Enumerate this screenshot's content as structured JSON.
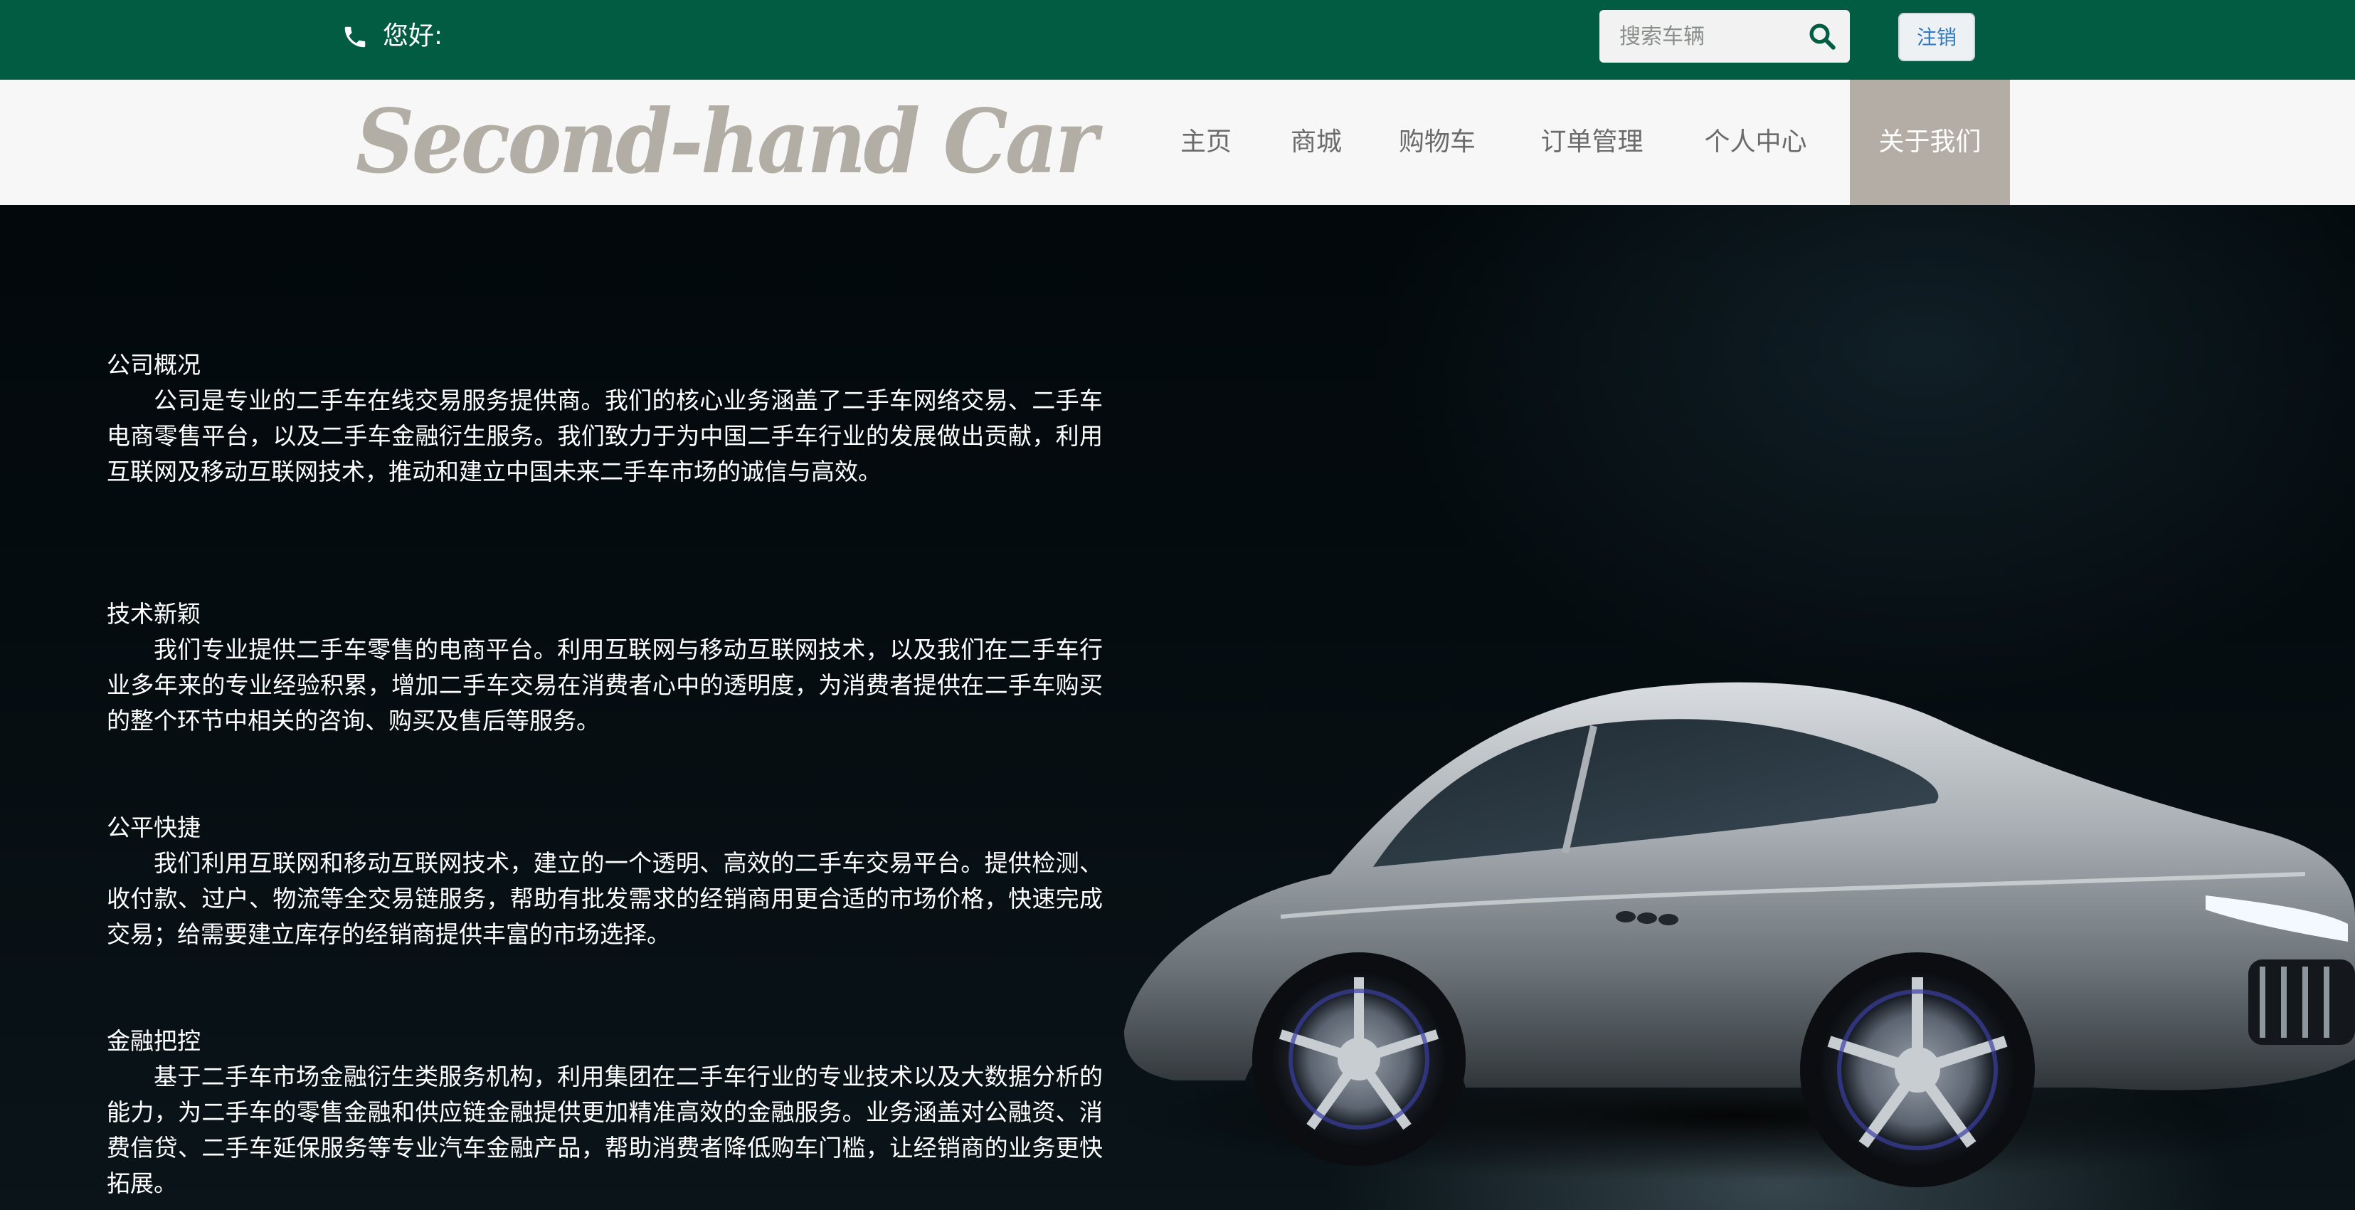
{
  "topbar": {
    "greeting": "您好:",
    "search": {
      "placeholder": "搜索车辆",
      "value": ""
    },
    "logout_label": "注销"
  },
  "navbar": {
    "logo_text": "Second-hand Car",
    "items": [
      {
        "label": "主页",
        "active": false
      },
      {
        "label": "商城",
        "active": false
      },
      {
        "label": "购物车",
        "active": false
      },
      {
        "label": "订单管理",
        "active": false
      },
      {
        "label": "个人中心",
        "active": false
      },
      {
        "label": "关于我们",
        "active": true
      }
    ]
  },
  "about": {
    "sections": [
      {
        "title": "公司概况",
        "body": "公司是专业的二手车在线交易服务提供商。我们的核心业务涵盖了二手车网络交易、二手车电商零售平台，以及二手车金融衍生服务。我们致力于为中国二手车行业的发展做出贡献，利用互联网及移动互联网技术，推动和建立中国未来二手车市场的诚信与高效。"
      },
      {
        "title": "技术新颖",
        "body": "我们专业提供二手车零售的电商平台。利用互联网与移动互联网技术，以及我们在二手车行业多年来的专业经验积累，增加二手车交易在消费者心中的透明度，为消费者提供在二手车购买的整个环节中相关的咨询、购买及售后等服务。"
      },
      {
        "title": "公平快捷",
        "body": "我们利用互联网和移动互联网技术，建立的一个透明、高效的二手车交易平台。提供检测、收付款、过户、物流等全交易链服务，帮助有批发需求的经销商用更合适的市场价格，快速完成交易；给需要建立库存的经销商提供丰富的市场选择。"
      },
      {
        "title": "金融把控",
        "body": "基于二手车市场金融衍生类服务机构，利用集团在二手车行业的专业技术以及大数据分析的能力，为二手车的零售金融和供应链金融提供更加精准高效的金融服务。业务涵盖对公融资、消费信贷、二手车延保服务等专业汽车金融产品，帮助消费者降低购车门槛，让经销商的业务更快拓展。"
      }
    ]
  },
  "colors": {
    "topbar": "#025c42",
    "navbar": "#f7f7f7",
    "nav_active": "#b3ada5",
    "logo": "#b2ada5",
    "logout_text": "#2e78c0"
  },
  "icons": {
    "phone": "phone-icon",
    "search": "search-icon"
  }
}
